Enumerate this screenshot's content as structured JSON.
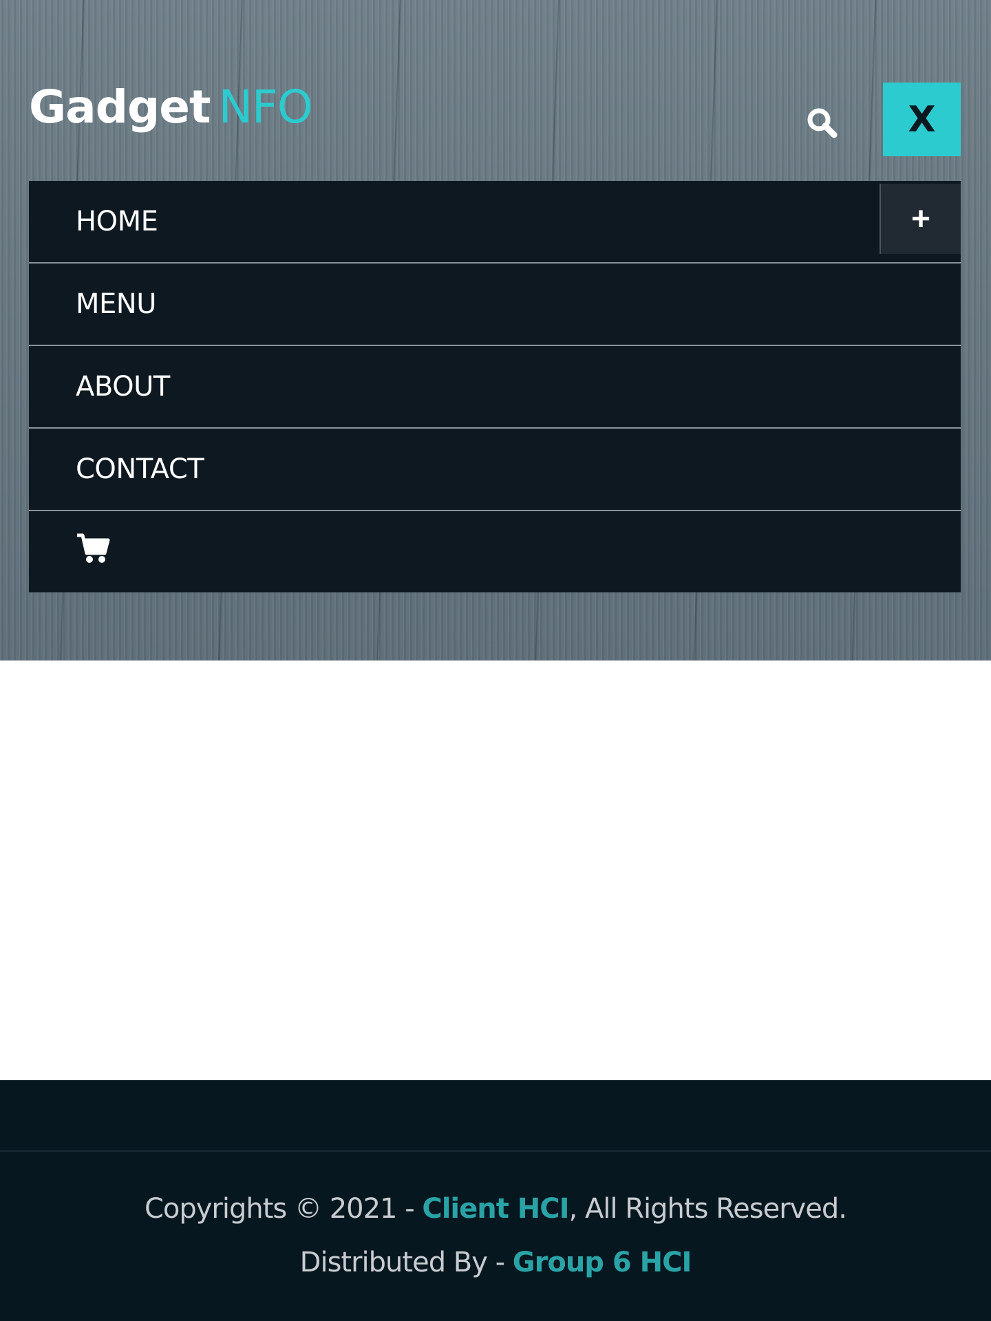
{
  "header": {
    "logo_part1": "Gadget",
    "logo_part2": "NFO",
    "search_icon": "search-icon",
    "close_label": "X"
  },
  "nav": {
    "items": [
      {
        "label": "HOME",
        "has_submenu": true
      },
      {
        "label": "MENU"
      },
      {
        "label": "ABOUT"
      },
      {
        "label": "CONTACT"
      },
      {
        "icon": "cart-icon"
      }
    ],
    "expand_label": "+"
  },
  "footer": {
    "copyright_prefix": "Copyrights © 2021 - ",
    "copyright_link": "Client HCI",
    "copyright_suffix": ", All Rights Reserved.",
    "distributed_prefix": "Distributed By - ",
    "distributed_link": "Group 6 HCI"
  },
  "colors": {
    "accent": "#2ccbcf",
    "nav_bg": "#0e1821",
    "footer_bg": "#071720",
    "footer_link": "#2aa3a6"
  }
}
